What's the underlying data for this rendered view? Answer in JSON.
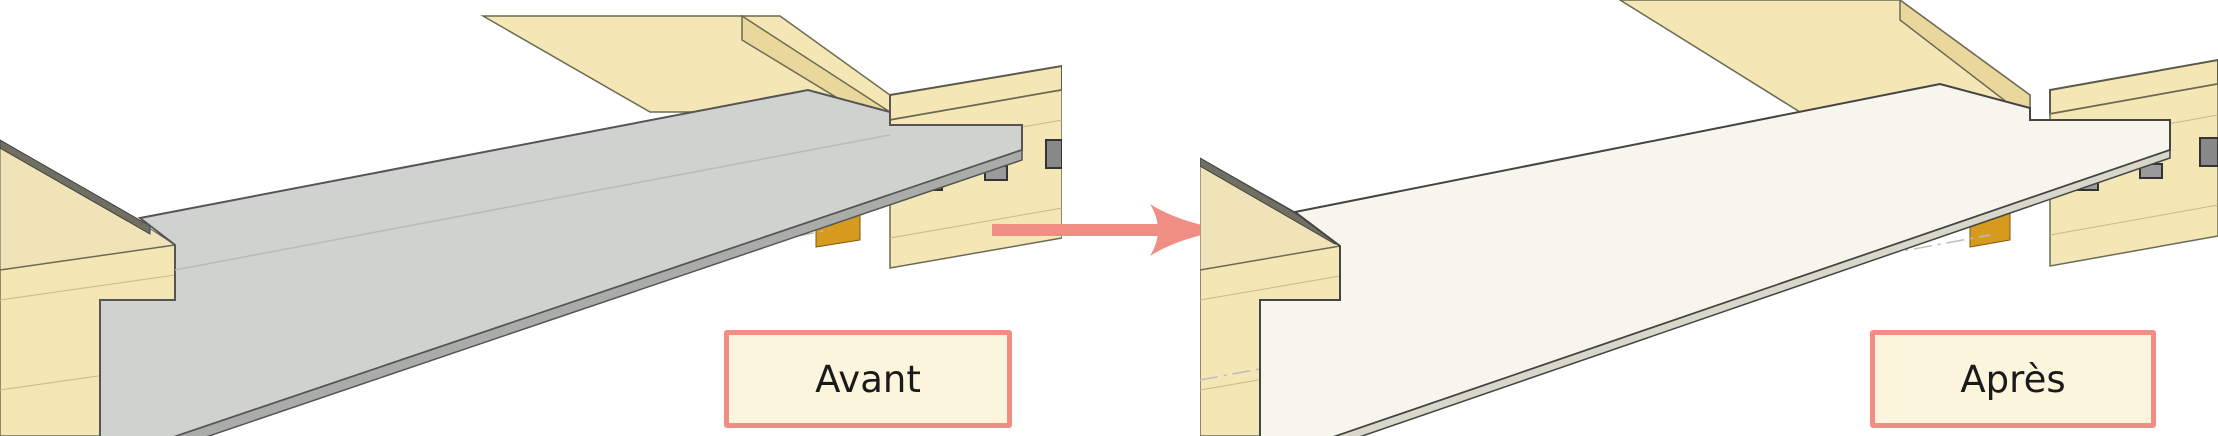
{
  "labels": {
    "before": "Avant",
    "after": "Après"
  },
  "colors": {
    "wood": "#f5e6b5",
    "wood_edge": "#5a5a48",
    "slab_before": "#cfd2cf",
    "slab_after": "#f6f6ec",
    "label_border": "#f08e84",
    "label_bg": "#fcf5de",
    "arrow": "#f08e84"
  },
  "icons": {
    "arrow": "right-arrow-icon"
  }
}
